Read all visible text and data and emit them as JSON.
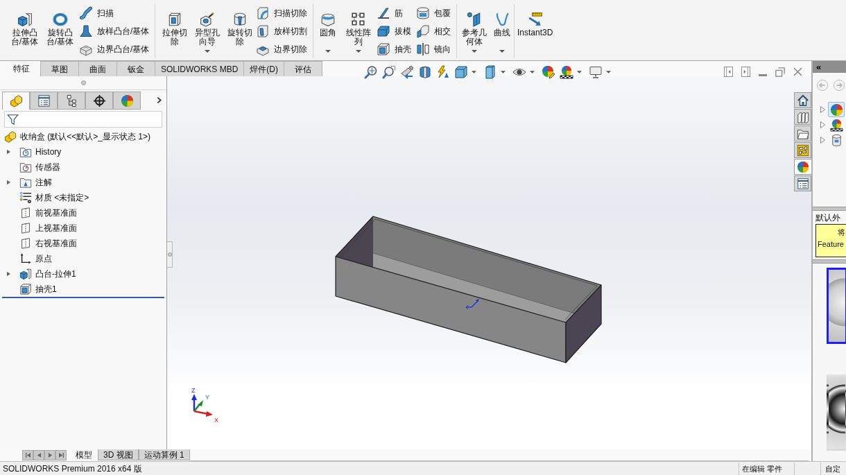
{
  "ribbon": {
    "groups": [
      {
        "items": [
          {
            "kind": "large",
            "label": "拉伸凸台/基体",
            "dropdown": false
          },
          {
            "kind": "large",
            "label": "旋转凸台/基体",
            "dropdown": false
          },
          {
            "kind": "stack",
            "entries": [
              "扫描",
              "放样凸台/基体",
              "边界凸台/基体"
            ]
          }
        ]
      },
      {
        "items": [
          {
            "kind": "large",
            "label": "拉伸切除",
            "dropdown": false
          },
          {
            "kind": "large",
            "label": "异型孔向导",
            "dropdown": true
          },
          {
            "kind": "large",
            "label": "旋转切除",
            "dropdown": false
          },
          {
            "kind": "stack",
            "entries": [
              "扫描切除",
              "放样切割",
              "边界切除"
            ]
          }
        ]
      },
      {
        "items": [
          {
            "kind": "large",
            "label": "圆角",
            "dropdown": true
          },
          {
            "kind": "large",
            "label": "线性阵列",
            "dropdown": true
          },
          {
            "kind": "stack",
            "entries": [
              "筋",
              "拔模",
              "抽壳"
            ]
          },
          {
            "kind": "stack",
            "entries": [
              "包覆",
              "相交",
              "镜向"
            ]
          }
        ]
      },
      {
        "items": [
          {
            "kind": "large",
            "label": "参考几何体",
            "dropdown": true
          },
          {
            "kind": "large",
            "label": "曲线",
            "dropdown": true
          }
        ]
      },
      {
        "items": [
          {
            "kind": "large",
            "label": "Instant3D",
            "dropdown": false
          }
        ]
      }
    ]
  },
  "tabs": [
    {
      "label": "特征",
      "selected": true
    },
    {
      "label": "草图",
      "selected": false
    },
    {
      "label": "曲面",
      "selected": false
    },
    {
      "label": "钣金",
      "selected": false
    },
    {
      "label": "SOLIDWORKS MBD",
      "selected": false
    },
    {
      "label": "焊件(D)",
      "selected": false
    },
    {
      "label": "评估",
      "selected": false
    }
  ],
  "view_toolbar": [
    {
      "dropdown": false
    },
    {
      "dropdown": false
    },
    {
      "dropdown": false
    },
    {
      "dropdown": false
    },
    {
      "dropdown": false
    },
    {
      "dropdown": true
    },
    {
      "dropdown": true
    },
    {
      "dropdown": true
    },
    {
      "dropdown": false
    },
    {
      "dropdown": true
    },
    {
      "dropdown": true
    }
  ],
  "feature_tree": {
    "panel_tabs": [
      {
        "selected": true
      },
      {
        "selected": false
      },
      {
        "selected": false
      },
      {
        "selected": false
      },
      {
        "selected": false
      }
    ],
    "root": {
      "label": "收纳盒 (默认<<默认>_显示状态 1>)",
      "children": [
        {
          "label": "History",
          "expandable": true
        },
        {
          "label": "传感器",
          "expandable": false
        },
        {
          "label": "注解",
          "expandable": true
        },
        {
          "label": "材质 <未指定>",
          "expandable": false
        },
        {
          "label": "前视基准面",
          "expandable": false
        },
        {
          "label": "上视基准面",
          "expandable": false
        },
        {
          "label": "右视基准面",
          "expandable": false
        },
        {
          "label": "原点",
          "expandable": false
        },
        {
          "label": "凸台-拉伸1",
          "expandable": true
        },
        {
          "label": "抽壳1",
          "expandable": false
        }
      ]
    }
  },
  "graphics": {
    "triad": {
      "axes": [
        {
          "label": "Z",
          "color": "#1f2fd6"
        },
        {
          "label": "Y",
          "color": "#1a8a2a"
        },
        {
          "label": "X",
          "color": "#d42020"
        }
      ]
    }
  },
  "task_pane": {
    "tabs": [
      {
        "selected": false
      },
      {
        "selected": false
      },
      {
        "selected": false
      },
      {
        "selected": false
      },
      {
        "selected": true
      },
      {
        "selected": false
      }
    ],
    "collapse_button": "«",
    "tree": [
      {
        "expandable": true,
        "selected": true
      },
      {
        "expandable": true,
        "selected": false
      },
      {
        "expandable": true,
        "selected": false
      }
    ],
    "section_label": "默认外",
    "note": {
      "lines": [
        "将",
        "Feature"
      ]
    },
    "thumbnails": [
      {
        "selected": true
      },
      {
        "selected": false
      }
    ]
  },
  "model_tabs": [
    {
      "label": "模型",
      "selected": true
    },
    {
      "label": "3D 视图",
      "selected": false
    },
    {
      "label": "运动算例 1",
      "selected": false
    }
  ],
  "status_bar": {
    "product": "SOLIDWORKS Premium 2016 x64 版",
    "mode": "在编辑 零件",
    "units": "自定"
  }
}
